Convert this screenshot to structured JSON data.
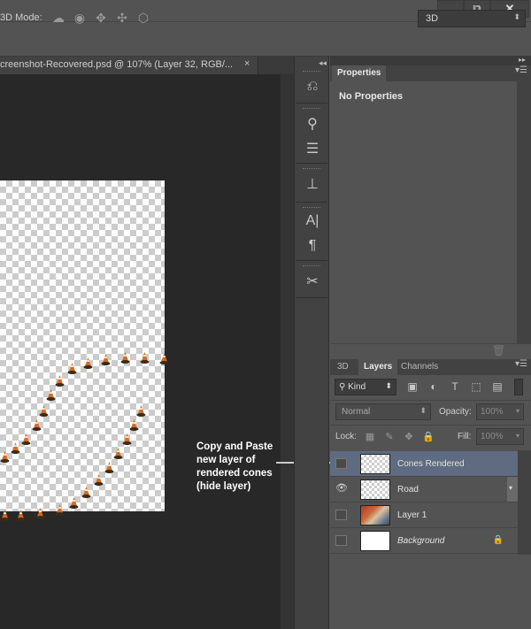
{
  "options_bar": {
    "mode_label": "3D Mode:",
    "mode_value": "3D"
  },
  "window_controls": {
    "minimize": "–",
    "maximize": "⧉",
    "close": "✕"
  },
  "document": {
    "tab_title": "creenshot-Recovered.psd @ 107% (Layer 32, RGB/...",
    "tab_close": "×"
  },
  "properties_panel": {
    "tab": "Properties",
    "content": "No Properties"
  },
  "layers_panel": {
    "tabs": [
      "3D",
      "Layers",
      "Channels"
    ],
    "active_tab": "Layers",
    "filter_kind": "Kind",
    "blend_mode": "Normal",
    "opacity_label": "Opacity:",
    "opacity_value": "100%",
    "lock_label": "Lock:",
    "fill_label": "Fill:",
    "fill_value": "100%",
    "layers": [
      {
        "name": "Cones Rendered",
        "visible": false,
        "selected": true,
        "thumb": "transparent"
      },
      {
        "name": "Road",
        "visible": true,
        "selected": false,
        "thumb": "transparent"
      },
      {
        "name": "Layer 1",
        "visible": false,
        "selected": false,
        "thumb": "photo"
      },
      {
        "name": "Background",
        "visible": false,
        "selected": false,
        "thumb": "white",
        "italic": true,
        "locked": true
      }
    ]
  },
  "annotation": {
    "text": "Copy and Paste new layer of rendered cones (hide layer)"
  },
  "colors": {
    "panel_bg": "#535353",
    "canvas_bg": "#282828",
    "selected_layer": "#5e6b80",
    "cone_orange": "#d96a1e"
  }
}
